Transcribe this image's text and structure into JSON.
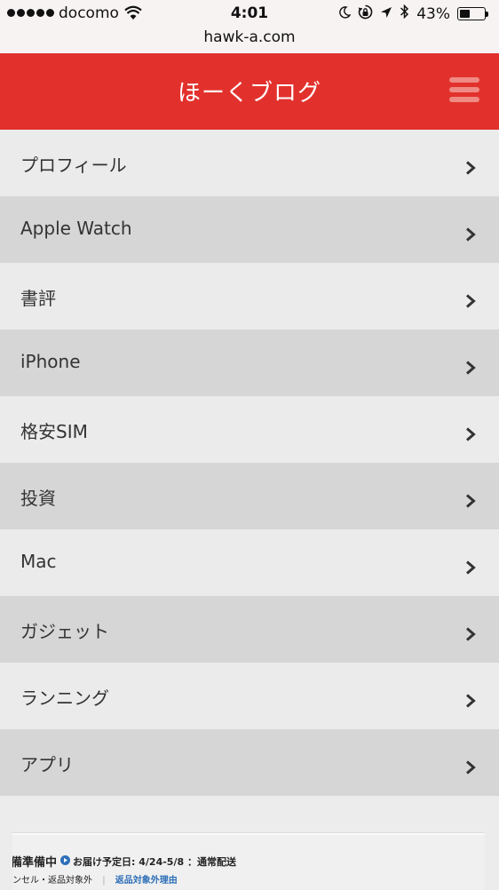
{
  "status_bar": {
    "carrier": "docomo",
    "time": "4:01",
    "battery_percent": "43%",
    "battery_level": 0.43,
    "signal_bars": 5,
    "icons": [
      "signal-dots-icon",
      "wifi-icon",
      "moon-icon",
      "rotation-lock-icon",
      "location-arrow-icon",
      "bluetooth-icon",
      "battery-icon"
    ]
  },
  "browser": {
    "url": "hawk-a.com"
  },
  "header": {
    "title": "ほーくブログ",
    "menu_icon": "hamburger-menu-icon",
    "background_color": "#e2312c"
  },
  "nav": {
    "items": [
      {
        "label": "プロフィール"
      },
      {
        "label": "Apple Watch"
      },
      {
        "label": "書評"
      },
      {
        "label": "iPhone"
      },
      {
        "label": "格安SIM"
      },
      {
        "label": "投資"
      },
      {
        "label": "Mac"
      },
      {
        "label": "ガジェット"
      },
      {
        "label": "ランニング"
      },
      {
        "label": "アプリ"
      }
    ],
    "item_icon": "chevron-right-icon"
  },
  "ad": {
    "status": "備準備中",
    "delivery_label": "お届け予定日: 4/24-5/8 ：通常配送",
    "note": "ンセル・返品対象外",
    "separator": "|",
    "link": "返品対象外理由"
  }
}
